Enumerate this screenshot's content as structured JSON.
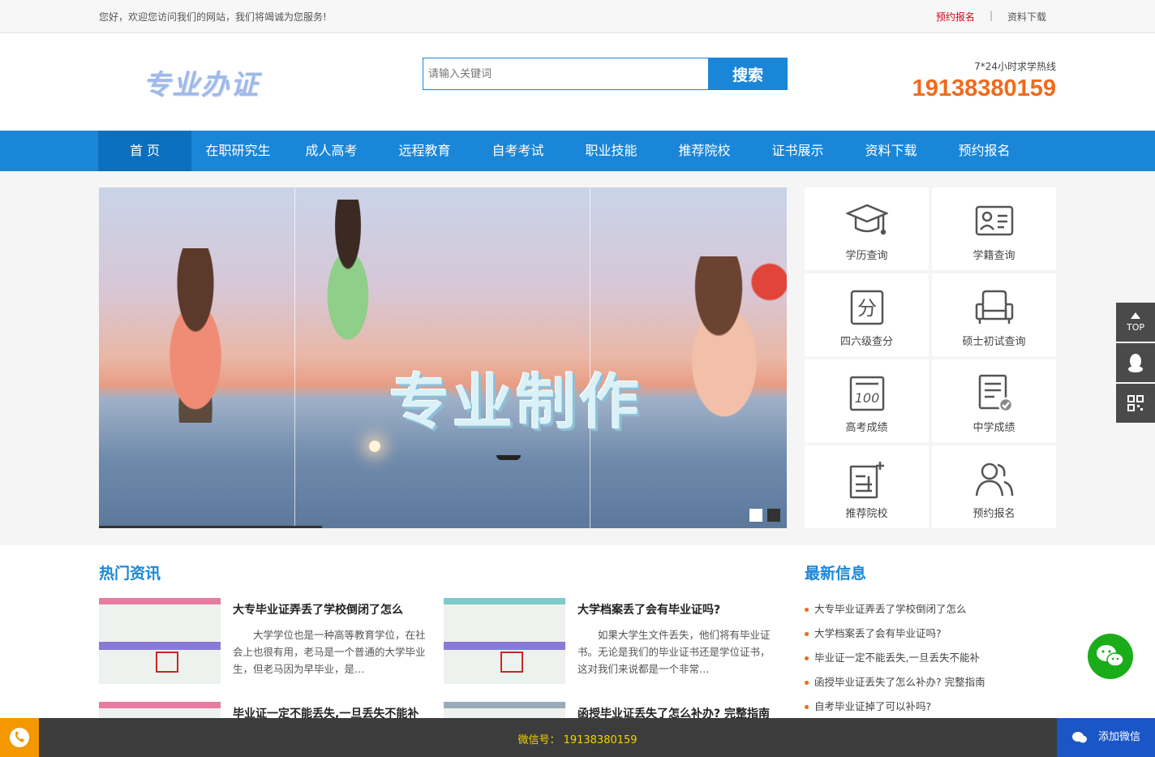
{
  "topbar": {
    "welcome": "您好，欢迎您访问我们的网站，我们将竭诚为您服务!",
    "link_signup": "预约报名",
    "separator": "|",
    "link_download": "资料下载"
  },
  "header": {
    "logo_text": "专业办证",
    "search_placeholder": "请输入关键词",
    "search_button": "搜索",
    "hotline_label": "7*24小时求学热线",
    "hotline_number": "19138380159"
  },
  "nav": {
    "items": [
      "首 页",
      "在职研究生",
      "成人高考",
      "远程教育",
      "自考考试",
      "职业技能",
      "推荐院校",
      "证书展示",
      "资料下载",
      "预约报名"
    ],
    "active_index": 0
  },
  "banner": {
    "title": "专业制作"
  },
  "quick_links": [
    {
      "label": "学历查询",
      "icon": "graduation-cap-icon"
    },
    {
      "label": "学籍查询",
      "icon": "id-card-icon"
    },
    {
      "label": "四六级查分",
      "icon": "score-fen-icon"
    },
    {
      "label": "硕士初试查询",
      "icon": "armchair-icon"
    },
    {
      "label": "高考成绩",
      "icon": "score-100-icon"
    },
    {
      "label": "中学成绩",
      "icon": "checklist-icon"
    },
    {
      "label": "推荐院校",
      "icon": "add-document-icon"
    },
    {
      "label": "预约报名",
      "icon": "users-icon"
    }
  ],
  "hot_news": {
    "title": "热门资讯",
    "items": [
      {
        "title": "大专毕业证弄丢了学校倒闭了怎么",
        "desc": "大学学位也是一种高等教育学位，在社会上也很有用，老马是一个普通的大学毕业生，但老马因为早毕业，是…"
      },
      {
        "title": "大学档案丢了会有毕业证吗?",
        "desc": "如果大学生文件丢失，他们将有毕业证书。无论是我们的毕业证书还是学位证书，这对我们来说都是一个非常…"
      },
      {
        "title": "毕业证一定不能丢失,一旦丢失不能补",
        "desc": ""
      },
      {
        "title": "函授毕业证丢失了怎么补办? 完整指南",
        "desc": ""
      }
    ]
  },
  "latest": {
    "title": "最新信息",
    "items": [
      "大专毕业证弄丢了学校倒闭了怎么",
      "大学档案丢了会有毕业证吗?",
      "毕业证一定不能丢失,一旦丢失不能补",
      "函授毕业证丢失了怎么补办? 完整指南",
      "自考毕业证掉了可以补吗?"
    ]
  },
  "sidetools": {
    "top_label": "TOP"
  },
  "footer": {
    "wechat_text": "微信号： 19138380159",
    "add_wechat": "添加微信"
  },
  "colors": {
    "primary": "#1a86d8",
    "accent": "#f06a1d",
    "wechat": "#1aad19",
    "footer": "#3c3c3c"
  }
}
